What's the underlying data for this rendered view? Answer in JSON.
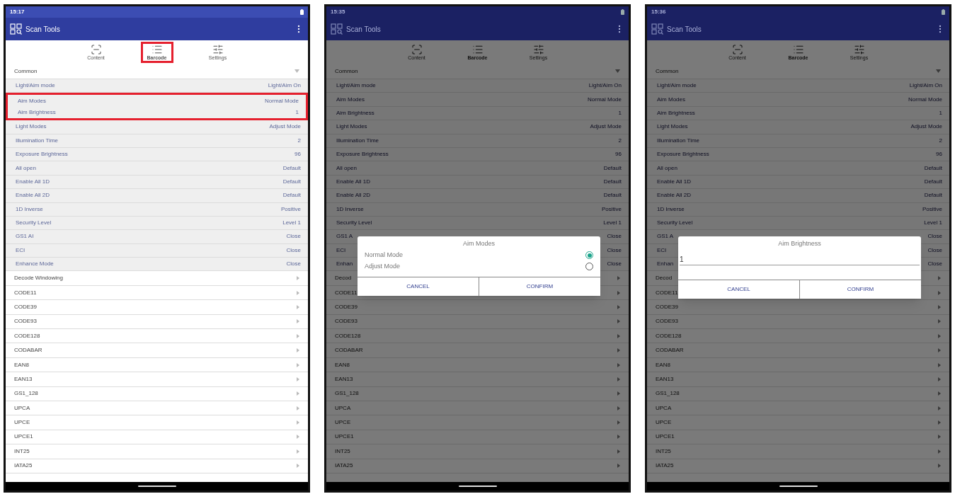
{
  "screens": [
    {
      "status_time": "15:17",
      "app_title": "Scan Tools",
      "dimmed": false,
      "tabs": [
        {
          "label": "Content",
          "selected": false,
          "highlighted": false
        },
        {
          "label": "Barcode",
          "selected": true,
          "highlighted": true
        },
        {
          "label": "Settings",
          "selected": false,
          "highlighted": false
        }
      ],
      "section": {
        "title": "Common",
        "expanded": true,
        "rows": [
          {
            "label": "Light/Aim mode",
            "value": "Light/Aim On",
            "highlighted": false
          },
          {
            "label": "Aim Modes",
            "value": "Normal Mode",
            "highlighted": true
          },
          {
            "label": "Aim Brightness",
            "value": "1",
            "highlighted": true
          },
          {
            "label": "Light Modes",
            "value": "Adjust Mode",
            "highlighted": false
          },
          {
            "label": "Illumination Time",
            "value": "2",
            "highlighted": false
          },
          {
            "label": "Exposure Brightness",
            "value": "96",
            "highlighted": false
          },
          {
            "label": "All open",
            "value": "Default",
            "highlighted": false
          },
          {
            "label": "Enable All 1D",
            "value": "Default",
            "highlighted": false
          },
          {
            "label": "Enable All 2D",
            "value": "Default",
            "highlighted": false
          },
          {
            "label": "1D Inverse",
            "value": "Positive",
            "highlighted": false
          },
          {
            "label": "Security Level",
            "value": "Level 1",
            "highlighted": false
          },
          {
            "label": "GS1 AI",
            "value": "Close",
            "highlighted": false
          },
          {
            "label": "ECI",
            "value": "Close",
            "highlighted": false
          },
          {
            "label": "Enhance Mode",
            "value": "Close",
            "highlighted": false
          }
        ]
      },
      "items": [
        "Decode Windowing",
        "CODE11",
        "CODE39",
        "CODE93",
        "CODE128",
        "CODABAR",
        "EAN8",
        "EAN13",
        "GS1_128",
        "UPCA",
        "UPCE",
        "UPCE1",
        "INT25",
        "IATA25"
      ]
    },
    {
      "status_time": "15:35",
      "app_title": "Scan Tools",
      "dimmed": true,
      "tabs": [
        {
          "label": "Content",
          "selected": false,
          "highlighted": false
        },
        {
          "label": "Barcode",
          "selected": true,
          "highlighted": false
        },
        {
          "label": "Settings",
          "selected": false,
          "highlighted": false
        }
      ],
      "section": {
        "title": "Common",
        "expanded": true,
        "rows": [
          {
            "label": "Light/Aim mode",
            "value": "Light/Aim On",
            "highlighted": false
          },
          {
            "label": "Aim Modes",
            "value": "Normal Mode",
            "highlighted": false
          },
          {
            "label": "Aim Brightness",
            "value": "1",
            "highlighted": false
          },
          {
            "label": "Light Modes",
            "value": "Adjust Mode",
            "highlighted": false
          },
          {
            "label": "Illumination Time",
            "value": "2",
            "highlighted": false
          },
          {
            "label": "Exposure Brightness",
            "value": "96",
            "highlighted": false
          },
          {
            "label": "All open",
            "value": "Default",
            "highlighted": false
          },
          {
            "label": "Enable All 1D",
            "value": "Default",
            "highlighted": false
          },
          {
            "label": "Enable All 2D",
            "value": "Default",
            "highlighted": false
          },
          {
            "label": "1D Inverse",
            "value": "Positive",
            "highlighted": false
          },
          {
            "label": "Security Level",
            "value": "Level 1",
            "highlighted": false
          },
          {
            "label": "GS1 A",
            "value": "Close",
            "highlighted": false
          },
          {
            "label": "ECI",
            "value": "Close",
            "highlighted": false
          },
          {
            "label": "Enhan",
            "value": "Close",
            "highlighted": false
          }
        ]
      },
      "items": [
        "Decod",
        "CODE11",
        "CODE39",
        "CODE93",
        "CODE128",
        "CODABAR",
        "EAN8",
        "EAN13",
        "GS1_128",
        "UPCA",
        "UPCE",
        "UPCE1",
        "INT25",
        "IATA25"
      ],
      "dialog": {
        "kind": "radio",
        "title": "Aim Modes",
        "options": [
          {
            "label": "Normal Mode",
            "selected": true
          },
          {
            "label": "Adjust Mode",
            "selected": false
          }
        ],
        "buttons": [
          "CANCEL",
          "CONFIRM"
        ]
      }
    },
    {
      "status_time": "15:36",
      "app_title": "Scan Tools",
      "dimmed": true,
      "tabs": [
        {
          "label": "Content",
          "selected": false,
          "highlighted": false
        },
        {
          "label": "Barcode",
          "selected": true,
          "highlighted": false
        },
        {
          "label": "Settings",
          "selected": false,
          "highlighted": false
        }
      ],
      "section": {
        "title": "Common",
        "expanded": true,
        "rows": [
          {
            "label": "Light/Aim mode",
            "value": "Light/Aim On",
            "highlighted": false
          },
          {
            "label": "Aim Modes",
            "value": "Normal Mode",
            "highlighted": false
          },
          {
            "label": "Aim Brightness",
            "value": "1",
            "highlighted": false
          },
          {
            "label": "Light Modes",
            "value": "Adjust Mode",
            "highlighted": false
          },
          {
            "label": "Illumination Time",
            "value": "2",
            "highlighted": false
          },
          {
            "label": "Exposure Brightness",
            "value": "96",
            "highlighted": false
          },
          {
            "label": "All open",
            "value": "Default",
            "highlighted": false
          },
          {
            "label": "Enable All 1D",
            "value": "Default",
            "highlighted": false
          },
          {
            "label": "Enable All 2D",
            "value": "Default",
            "highlighted": false
          },
          {
            "label": "1D Inverse",
            "value": "Positive",
            "highlighted": false
          },
          {
            "label": "Security Level",
            "value": "Level 1",
            "highlighted": false
          },
          {
            "label": "GS1 A",
            "value": "Close",
            "highlighted": false
          },
          {
            "label": "ECI",
            "value": "Close",
            "highlighted": false
          },
          {
            "label": "Enhan",
            "value": "Close",
            "highlighted": false
          }
        ]
      },
      "items": [
        "Decod",
        "CODE11",
        "CODE39",
        "CODE93",
        "CODE128",
        "CODABAR",
        "EAN8",
        "EAN13",
        "GS1_128",
        "UPCA",
        "UPCE",
        "UPCE1",
        "INT25",
        "IATA25"
      ],
      "dialog": {
        "kind": "input",
        "title": "Aim Brightness",
        "value": "1",
        "buttons": [
          "CANCEL",
          "CONFIRM"
        ]
      }
    }
  ]
}
